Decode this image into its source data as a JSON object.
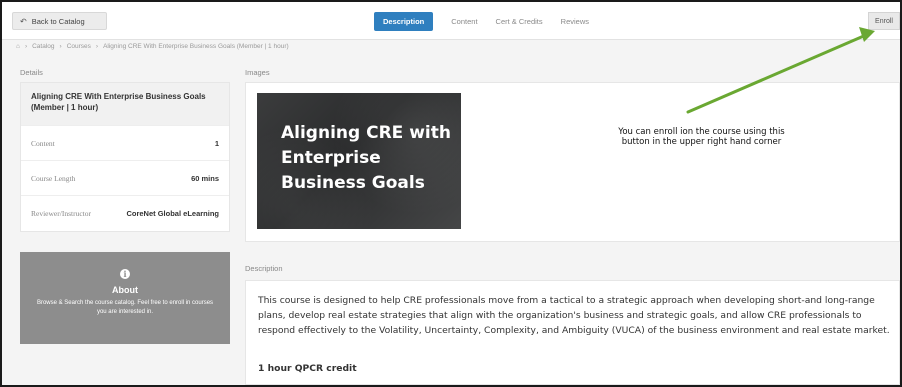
{
  "header": {
    "back_label": "Back to Catalog",
    "tabs": [
      {
        "label": "Description",
        "active": true
      },
      {
        "label": "Content",
        "active": false
      },
      {
        "label": "Cert & Credits",
        "active": false
      },
      {
        "label": "Reviews",
        "active": false
      }
    ],
    "enroll_label": "Enroll"
  },
  "breadcrumb": {
    "items": [
      "Catalog",
      "Courses",
      "Aligning CRE With Enterprise Business Goals (Member | 1 hour)"
    ]
  },
  "details": {
    "section_label": "Details",
    "course_title": "Aligning CRE With Enterprise Business Goals (Member | 1 hour)",
    "rows": [
      {
        "key": "Content",
        "value": "1"
      },
      {
        "key": "Course Length",
        "value": "60 mins"
      },
      {
        "key": "Reviewer/Instructor",
        "value": "CoreNet Global eLearning"
      }
    ]
  },
  "about": {
    "icon": "info-icon",
    "title": "About",
    "text": "Browse & Search the course catalog. Feel free to enroll in courses you are interested in."
  },
  "images": {
    "section_label": "Images",
    "course_image_title": "Aligning CRE with Enterprise Business Goals"
  },
  "annotation": {
    "text": "You can enroll ion the course using this button in the upper right hand corner",
    "arrow_color": "#6aa832"
  },
  "description": {
    "section_label": "Description",
    "body": "This course is designed to help CRE professionals move from a tactical to a strategic approach when developing short-and long-range plans, develop real estate strategies that align with the organization's business and strategic goals, and allow CRE professionals to respond effectively to the Volatility, Uncertainty, Complexity, and Ambiguity (VUCA) of the business environment and real estate market.",
    "credit": "1 hour QPCR credit"
  },
  "colors": {
    "accent": "#2f7fbf",
    "about_bg": "#8d8d8d"
  }
}
